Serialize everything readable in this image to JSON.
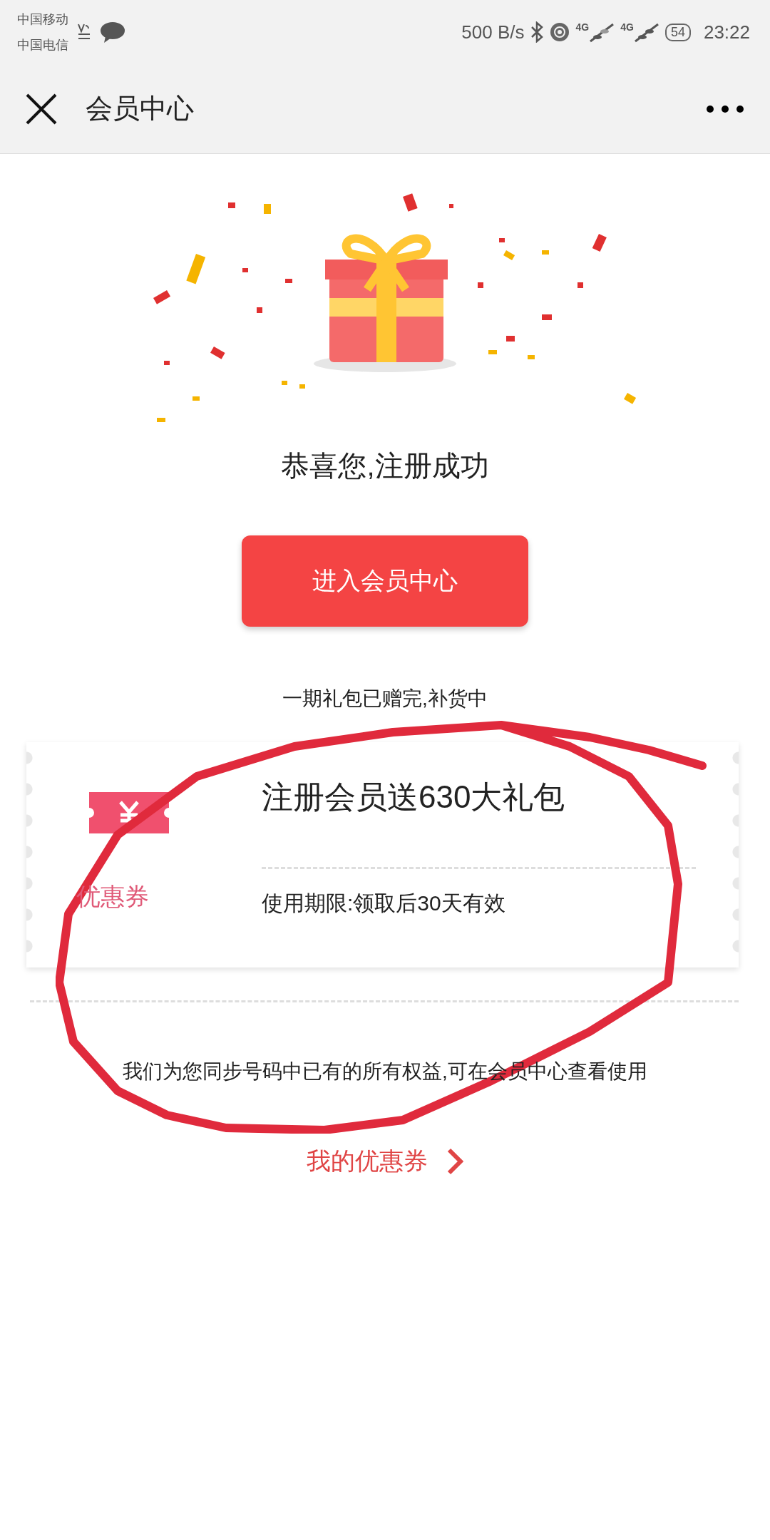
{
  "status_bar": {
    "carriers": [
      "中国移动",
      "中国电信"
    ],
    "speed": "500 B/s",
    "networks": [
      "4G",
      "4G"
    ],
    "battery": "54",
    "time": "23:22"
  },
  "nav": {
    "title": "会员中心"
  },
  "success": {
    "message": "恭喜您,注册成功",
    "button": "进入会员中心",
    "notice": "一期礼包已赠完,补货中"
  },
  "coupon": {
    "label": "优惠券",
    "title": "注册会员送630大礼包",
    "validity": "使用期限:领取后30天有效"
  },
  "sync_note": "我们为您同步号码中已有的所有权益,可在会员中心查看使用",
  "my_coupons_link": "我的优惠券"
}
